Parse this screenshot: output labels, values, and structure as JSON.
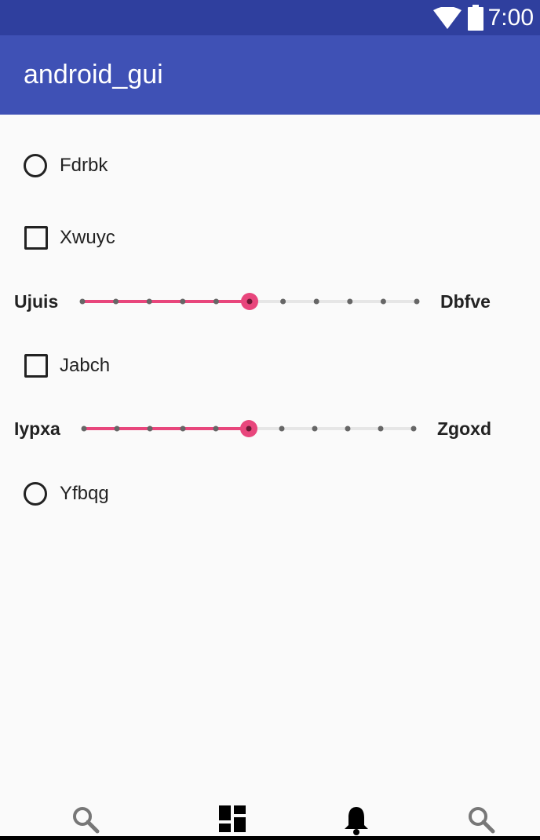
{
  "status_bar": {
    "time": "7:00",
    "icons": [
      "wifi-icon",
      "battery-icon"
    ]
  },
  "app_bar": {
    "title": "android_gui"
  },
  "form": {
    "radio_1": {
      "label": "Fdrbk",
      "checked": false
    },
    "checkbox_1": {
      "label": "Xwuyc",
      "checked": false
    },
    "seekbar_1": {
      "left_label": "Ujuis",
      "right_label": "Dbfve",
      "value": 5,
      "max": 10
    },
    "checkbox_2": {
      "label": "Jabch",
      "checked": false
    },
    "seekbar_2": {
      "left_label": "Iypxa",
      "right_label": "Zgoxd",
      "value": 5,
      "max": 10
    },
    "radio_2": {
      "label": "Yfbqg",
      "checked": false
    }
  },
  "bottom_nav": {
    "items": [
      "search-icon",
      "dashboard-icon",
      "notifications-icon",
      "search-icon"
    ]
  },
  "colors": {
    "status_bar": "#2f3f9e",
    "app_bar": "#3f51b5",
    "accent": "#e8467c",
    "background": "#fafafa"
  }
}
